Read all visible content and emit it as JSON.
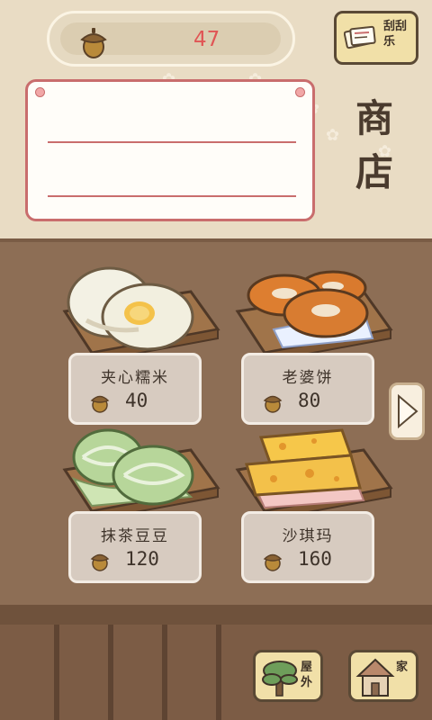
{
  "header": {
    "acorn_count": "47",
    "scratch_label": "刮刮乐",
    "shop_title": "商店"
  },
  "items": [
    {
      "name": "夹心糯米",
      "price": "40"
    },
    {
      "name": "老婆饼",
      "price": "80"
    },
    {
      "name": "抹茶豆豆",
      "price": "120"
    },
    {
      "name": "沙琪玛",
      "price": "160"
    }
  ],
  "nav": {
    "outside_label": "屋外",
    "home_label": "家"
  },
  "colors": {
    "accent_red": "#e05555",
    "wood_brown": "#8d6e55",
    "button_yellow": "#f1e0a8"
  }
}
